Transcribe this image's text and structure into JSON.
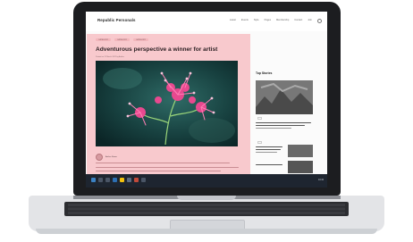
{
  "site": {
    "brand": "Republic Personals",
    "nav": [
      "Latest",
      "Events",
      "Style",
      "Pages",
      "Membership",
      "Contact",
      "Join"
    ]
  },
  "article": {
    "crumbs": [
      "CATEGORY",
      "CATEGORY",
      "CATEGORY"
    ],
    "title": "Adventurous perspective a winner for artist",
    "dateline": "Posted on 12 March 2022 by Author",
    "author": "Author Name"
  },
  "sidebar": {
    "top_stories_label": "Top Stories"
  },
  "taskbar": {
    "clock": "10:34"
  },
  "colors": {
    "article_bg": "#f8c9cd",
    "taskbar_bg": "#1e2530",
    "accent_yellow": "#f4c20d"
  }
}
